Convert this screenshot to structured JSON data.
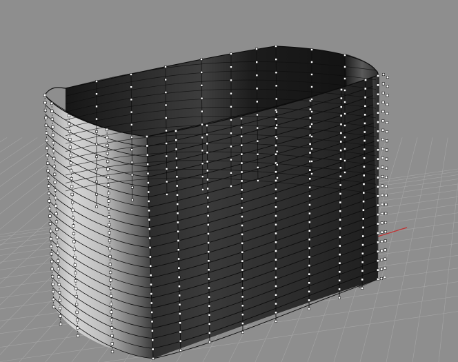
{
  "viewport": {
    "view": "perspective",
    "background_color": "#8e8e8e",
    "grid_color": "#a6a6a6",
    "x_axis_color": "#c03030",
    "surface_color": "#3a3a3a",
    "isocurve_color": "#0d0d0d",
    "control_point_color": "#ffffff"
  },
  "model": {
    "object": "rounded-box-nurbs-surface",
    "control_points_visible": true,
    "isocurve_rows": 22
  }
}
